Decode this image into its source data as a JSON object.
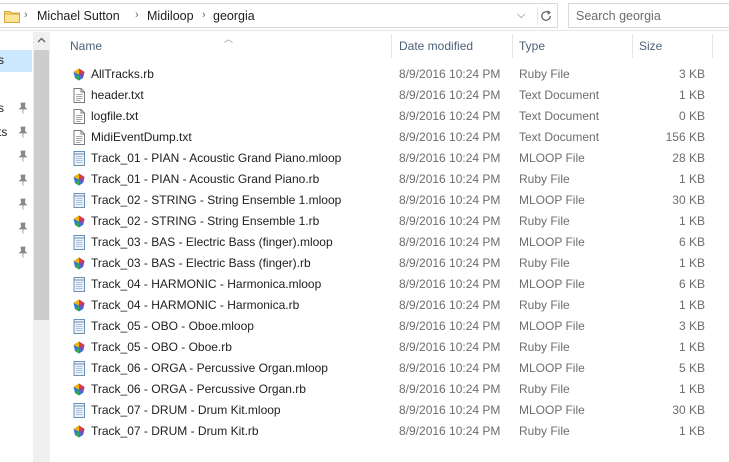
{
  "breadcrumb": [
    "Michael Sutton",
    "Midiloop",
    "georgia"
  ],
  "search": {
    "placeholder": "Search georgia"
  },
  "nav": {
    "items": [
      {
        "label": "s",
        "pinned": false,
        "selected": true
      },
      {
        "label": "s",
        "pinned": true,
        "selected": false
      },
      {
        "label": "ts",
        "pinned": true,
        "selected": false
      },
      {
        "label": "",
        "pinned": true,
        "selected": false
      },
      {
        "label": "",
        "pinned": true,
        "selected": false
      },
      {
        "label": "",
        "pinned": true,
        "selected": false
      },
      {
        "label": "",
        "pinned": true,
        "selected": false
      },
      {
        "label": "",
        "pinned": true,
        "selected": false
      }
    ]
  },
  "columns": {
    "name": "Name",
    "date": "Date modified",
    "type": "Type",
    "size": "Size"
  },
  "files": [
    {
      "name": "AllTracks.rb",
      "date": "8/9/2016 10:24 PM",
      "type": "Ruby File",
      "size": "3 KB",
      "icon": "ruby-file-icon"
    },
    {
      "name": "header.txt",
      "date": "8/9/2016 10:24 PM",
      "type": "Text Document",
      "size": "1 KB",
      "icon": "text-file-icon"
    },
    {
      "name": "logfile.txt",
      "date": "8/9/2016 10:24 PM",
      "type": "Text Document",
      "size": "0 KB",
      "icon": "text-file-icon"
    },
    {
      "name": "MidiEventDump.txt",
      "date": "8/9/2016 10:24 PM",
      "type": "Text Document",
      "size": "156 KB",
      "icon": "text-file-icon"
    },
    {
      "name": "Track_01 - PIAN - Acoustic Grand Piano.mloop",
      "date": "8/9/2016 10:24 PM",
      "type": "MLOOP File",
      "size": "28 KB",
      "icon": "mloop-file-icon"
    },
    {
      "name": "Track_01 - PIAN - Acoustic Grand Piano.rb",
      "date": "8/9/2016 10:24 PM",
      "type": "Ruby File",
      "size": "1 KB",
      "icon": "ruby-file-icon"
    },
    {
      "name": "Track_02 - STRING - String Ensemble 1.mloop",
      "date": "8/9/2016 10:24 PM",
      "type": "MLOOP File",
      "size": "30 KB",
      "icon": "mloop-file-icon"
    },
    {
      "name": "Track_02 - STRING - String Ensemble 1.rb",
      "date": "8/9/2016 10:24 PM",
      "type": "Ruby File",
      "size": "1 KB",
      "icon": "ruby-file-icon"
    },
    {
      "name": "Track_03 - BAS - Electric Bass (finger).mloop",
      "date": "8/9/2016 10:24 PM",
      "type": "MLOOP File",
      "size": "6 KB",
      "icon": "mloop-file-icon"
    },
    {
      "name": "Track_03 - BAS - Electric Bass (finger).rb",
      "date": "8/9/2016 10:24 PM",
      "type": "Ruby File",
      "size": "1 KB",
      "icon": "ruby-file-icon"
    },
    {
      "name": "Track_04 - HARMONIC - Harmonica.mloop",
      "date": "8/9/2016 10:24 PM",
      "type": "MLOOP File",
      "size": "6 KB",
      "icon": "mloop-file-icon"
    },
    {
      "name": "Track_04 - HARMONIC - Harmonica.rb",
      "date": "8/9/2016 10:24 PM",
      "type": "Ruby File",
      "size": "1 KB",
      "icon": "ruby-file-icon"
    },
    {
      "name": "Track_05 - OBO - Oboe.mloop",
      "date": "8/9/2016 10:24 PM",
      "type": "MLOOP File",
      "size": "3 KB",
      "icon": "mloop-file-icon"
    },
    {
      "name": "Track_05 - OBO - Oboe.rb",
      "date": "8/9/2016 10:24 PM",
      "type": "Ruby File",
      "size": "1 KB",
      "icon": "ruby-file-icon"
    },
    {
      "name": "Track_06 - ORGA - Percussive Organ.mloop",
      "date": "8/9/2016 10:24 PM",
      "type": "MLOOP File",
      "size": "5 KB",
      "icon": "mloop-file-icon"
    },
    {
      "name": "Track_06 - ORGA - Percussive Organ.rb",
      "date": "8/9/2016 10:24 PM",
      "type": "Ruby File",
      "size": "1 KB",
      "icon": "ruby-file-icon"
    },
    {
      "name": "Track_07 - DRUM - Drum Kit.mloop",
      "date": "8/9/2016 10:24 PM",
      "type": "MLOOP File",
      "size": "30 KB",
      "icon": "mloop-file-icon"
    },
    {
      "name": "Track_07 - DRUM - Drum Kit.rb",
      "date": "8/9/2016 10:24 PM",
      "type": "Ruby File",
      "size": "1 KB",
      "icon": "ruby-file-icon"
    }
  ],
  "colors": {
    "header_text": "#4c607a",
    "selected_nav": "#cce8ff",
    "folder": "#f8d775"
  }
}
